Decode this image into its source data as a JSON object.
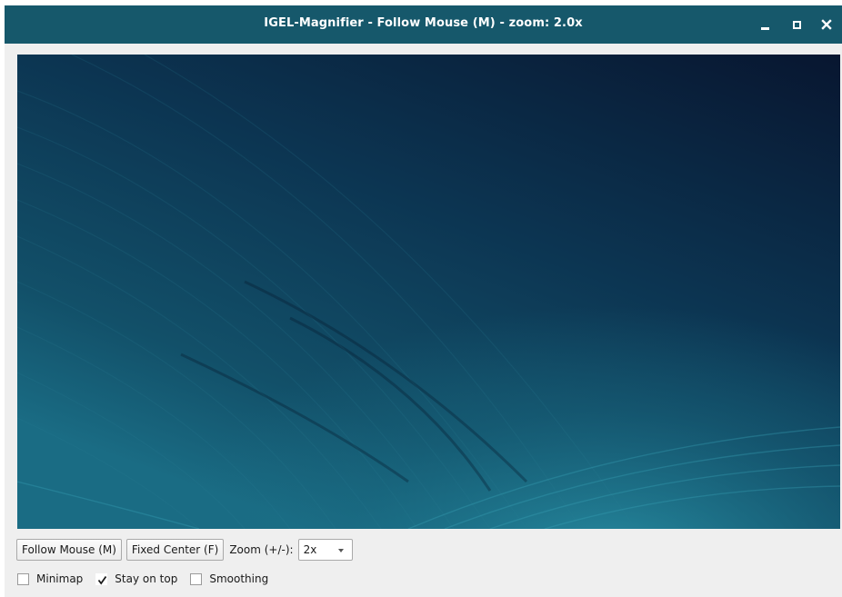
{
  "window": {
    "title": "IGEL-Magnifier - Follow Mouse (M) - zoom: 2.0x",
    "titlebar_color": "#16586b",
    "controls": {
      "minimize_icon": "minimize-icon",
      "maximize_icon": "maximize-icon",
      "close_icon": "close-icon"
    }
  },
  "viewport": {
    "content": "magnified-desktop-wallpaper",
    "colors": {
      "top": "#0a1a35",
      "middle": "#0e4460",
      "bottom": "#1d7a90"
    }
  },
  "toolbar": {
    "follow_mouse_label": "Follow Mouse (M)",
    "fixed_center_label": "Fixed Center (F)",
    "zoom_label": "Zoom (+/-):",
    "zoom_selected": "2x"
  },
  "options": [
    {
      "label": "Minimap",
      "checked": false
    },
    {
      "label": "Stay on top",
      "checked": true
    },
    {
      "label": "Smoothing",
      "checked": false
    }
  ]
}
